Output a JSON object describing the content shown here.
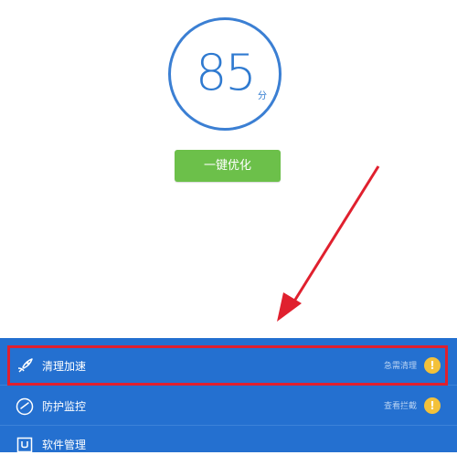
{
  "score": {
    "value": "85",
    "unit": "分"
  },
  "optimize_button": {
    "label": "一键优化"
  },
  "features": [
    {
      "label": "清理加速",
      "status": "急需清理",
      "icon": "rocket-icon",
      "warning": "!"
    },
    {
      "label": "防护监控",
      "status": "查看拦截",
      "icon": "gauge-icon",
      "warning": "!"
    },
    {
      "label": "软件管理",
      "icon": "bag-icon"
    }
  ],
  "colors": {
    "accent": "#2470d0",
    "score": "#2f7ad0",
    "button": "#6cc04a",
    "highlight": "#e0202e",
    "warning": "#f3c13a"
  }
}
